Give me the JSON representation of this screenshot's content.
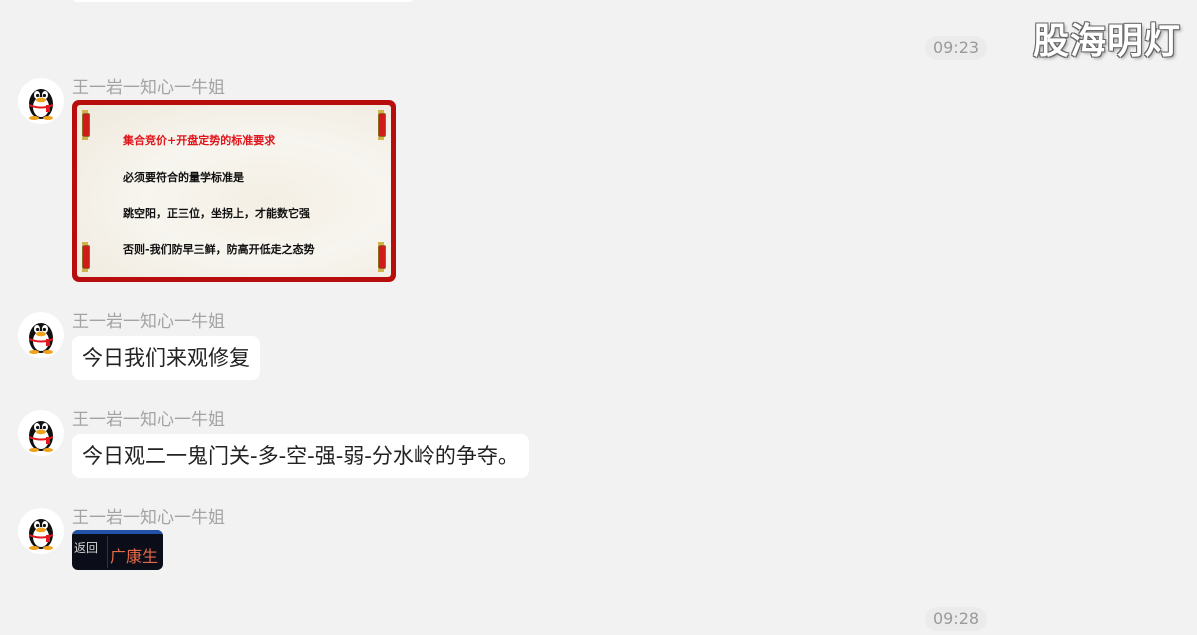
{
  "watermark": "股海明灯",
  "timestamps": [
    "09:23",
    "09:28"
  ],
  "messages": [
    {
      "sender": "王一岩一知心一牛姐",
      "type": "image",
      "image": {
        "title": "集合竞价+开盘定势的标准要求",
        "lines": [
          "必须要符合的量学标准是",
          "跳空阳，正三位，坐拐上，才能数它强",
          "否则-我们防早三鲜，防高开低走之态势"
        ]
      }
    },
    {
      "sender": "王一岩一知心一牛姐",
      "type": "text",
      "text": "今日我们来观修复"
    },
    {
      "sender": "王一岩一知心一牛姐",
      "type": "text",
      "text": "今日观二一鬼门关-多-空-强-弱-分水岭的争夺。"
    },
    {
      "sender": "王一岩一知心一牛姐",
      "type": "thumbnail",
      "thumbnail": {
        "back": "返回",
        "label": "广康生"
      }
    }
  ],
  "icons": {
    "avatar": "qq-penguin-icon"
  },
  "colors": {
    "background": "#f2f2f2",
    "bubble": "#ffffff",
    "sender": "#a3a3a3",
    "scroll_border": "#b70d0d",
    "scroll_title": "#e0141a"
  }
}
